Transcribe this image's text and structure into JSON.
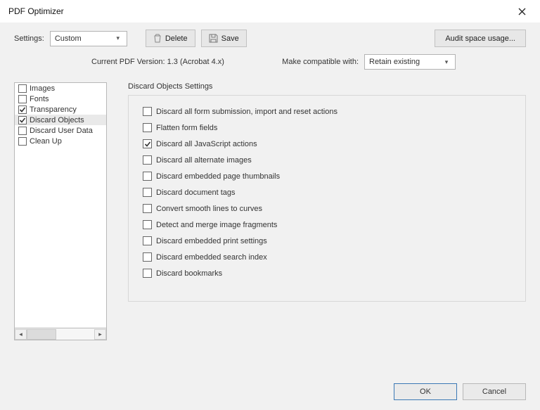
{
  "window": {
    "title": "PDF Optimizer"
  },
  "toolbar": {
    "settings_label": "Settings:",
    "settings_value": "Custom",
    "delete_label": "Delete",
    "save_label": "Save",
    "audit_label": "Audit space usage..."
  },
  "info": {
    "current_version": "Current PDF Version: 1.3 (Acrobat 4.x)",
    "compat_label": "Make compatible with:",
    "compat_value": "Retain existing"
  },
  "sidebar": {
    "items": [
      {
        "label": "Images",
        "checked": false,
        "selected": false
      },
      {
        "label": "Fonts",
        "checked": false,
        "selected": false
      },
      {
        "label": "Transparency",
        "checked": true,
        "selected": false
      },
      {
        "label": "Discard Objects",
        "checked": true,
        "selected": true
      },
      {
        "label": "Discard User Data",
        "checked": false,
        "selected": false
      },
      {
        "label": "Clean Up",
        "checked": false,
        "selected": false
      }
    ]
  },
  "panel": {
    "title": "Discard Objects Settings",
    "options": [
      {
        "label": "Discard all form submission, import and reset actions",
        "checked": false
      },
      {
        "label": "Flatten form fields",
        "checked": false
      },
      {
        "label": "Discard all JavaScript actions",
        "checked": true
      },
      {
        "label": "Discard all alternate images",
        "checked": false
      },
      {
        "label": "Discard embedded page thumbnails",
        "checked": false
      },
      {
        "label": "Discard document tags",
        "checked": false
      },
      {
        "label": "Convert smooth lines to curves",
        "checked": false
      },
      {
        "label": "Detect and merge image fragments",
        "checked": false
      },
      {
        "label": "Discard embedded print settings",
        "checked": false
      },
      {
        "label": "Discard embedded search index",
        "checked": false
      },
      {
        "label": "Discard bookmarks",
        "checked": false
      }
    ]
  },
  "footer": {
    "ok_label": "OK",
    "cancel_label": "Cancel"
  }
}
